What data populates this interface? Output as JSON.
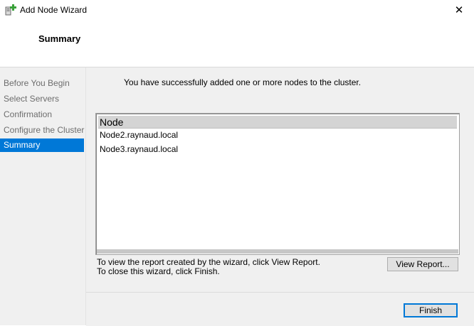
{
  "window": {
    "title": "Add Node Wizard",
    "close_glyph": "✕",
    "icon": "add-node-icon"
  },
  "header": {
    "title": "Summary"
  },
  "sidebar": {
    "steps": [
      {
        "label": "Before You Begin",
        "active": false
      },
      {
        "label": "Select Servers",
        "active": false
      },
      {
        "label": "Confirmation",
        "active": false
      },
      {
        "label": "Configure the Cluster",
        "active": false
      },
      {
        "label": "Summary",
        "active": true
      }
    ]
  },
  "main": {
    "intro": "You have successfully added one or more nodes to the cluster.",
    "list": {
      "header": "Node",
      "rows": [
        "Node2.raynaud.local",
        "Node3.raynaud.local"
      ]
    },
    "info_line1": "To view the report created by the wizard, click View Report.",
    "info_line2": "To close this wizard, click Finish.",
    "view_report_label": "View Report..."
  },
  "footer": {
    "finish_label": "Finish"
  },
  "colors": {
    "accent": "#0078d7",
    "panel": "#f0f0f0",
    "icon_green": "#3aa13a"
  }
}
